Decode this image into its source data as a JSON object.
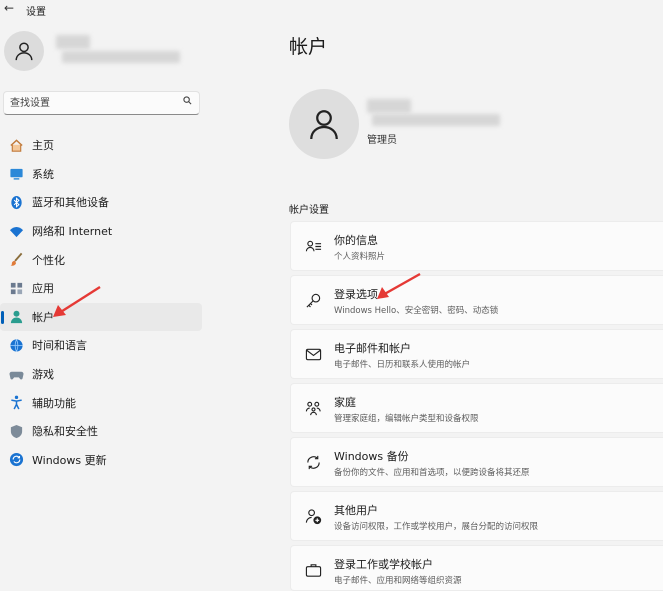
{
  "window": {
    "title": "设置",
    "back_glyph": "←"
  },
  "search": {
    "placeholder": "查找设置"
  },
  "sidebar": {
    "items": [
      {
        "label": "主页",
        "icon": "home-icon"
      },
      {
        "label": "系统",
        "icon": "system-icon"
      },
      {
        "label": "蓝牙和其他设备",
        "icon": "bluetooth-icon"
      },
      {
        "label": "网络和 Internet",
        "icon": "wifi-icon"
      },
      {
        "label": "个性化",
        "icon": "brush-icon"
      },
      {
        "label": "应用",
        "icon": "apps-icon"
      },
      {
        "label": "帐户",
        "icon": "account-icon",
        "active": true
      },
      {
        "label": "时间和语言",
        "icon": "globe-clock-icon"
      },
      {
        "label": "游戏",
        "icon": "gamepad-icon"
      },
      {
        "label": "辅助功能",
        "icon": "accessibility-icon"
      },
      {
        "label": "隐私和安全性",
        "icon": "shield-icon"
      },
      {
        "label": "Windows 更新",
        "icon": "update-icon"
      }
    ]
  },
  "main": {
    "title": "帐户",
    "account": {
      "role": "管理员"
    },
    "section_label": "帐户设置",
    "cards": [
      {
        "title": "你的信息",
        "subtitle": "个人资料照片",
        "icon": "person-card-icon"
      },
      {
        "title": "登录选项",
        "subtitle": "Windows Hello、安全密钥、密码、动态锁",
        "icon": "key-icon"
      },
      {
        "title": "电子邮件和帐户",
        "subtitle": "电子邮件、日历和联系人使用的帐户",
        "icon": "mail-icon"
      },
      {
        "title": "家庭",
        "subtitle": "管理家庭组，编辑帐户类型和设备权限",
        "icon": "family-icon"
      },
      {
        "title": "Windows 备份",
        "subtitle": "备份你的文件、应用和首选项，以便跨设备将其还原",
        "icon": "backup-icon"
      },
      {
        "title": "其他用户",
        "subtitle": "设备访问权限，工作或学校用户，展台分配的访问权限",
        "icon": "add-user-icon"
      },
      {
        "title": "登录工作或学校帐户",
        "subtitle": "电子邮件、应用和网络等组织资源",
        "icon": "briefcase-icon"
      }
    ]
  },
  "colors": {
    "accent": "#005fb8",
    "annotation_arrow": "#e53935",
    "background": "#f3f3f3",
    "card": "#fbfbfb"
  }
}
